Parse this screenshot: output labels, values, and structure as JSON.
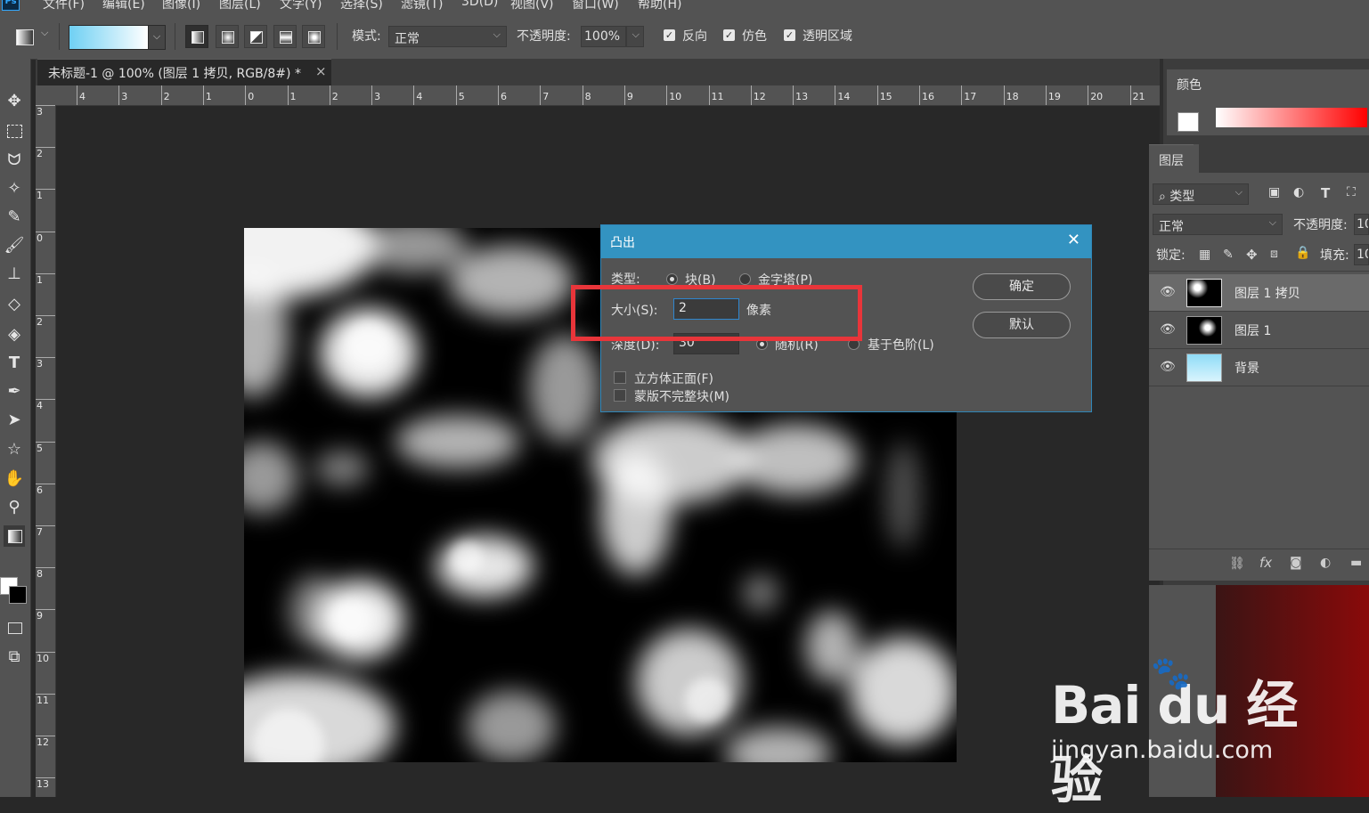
{
  "menubar": {
    "app_logo": "Ps",
    "items": [
      "文件(F)",
      "编辑(E)",
      "图像(I)",
      "图层(L)",
      "文字(Y)",
      "选择(S)",
      "滤镜(T)",
      "3D(D)",
      "视图(V)",
      "窗口(W)",
      "帮助(H)"
    ]
  },
  "options_bar": {
    "mode_label": "模式:",
    "mode_value": "正常",
    "opacity_label": "不透明度:",
    "opacity_value": "100%",
    "reverse_label": "反向",
    "dither_label": "仿色",
    "transparency_label": "透明区域",
    "gradient_colors": [
      "#6fd0f3",
      "#ffffff"
    ]
  },
  "document": {
    "tab_title": "未标题-1 @ 100% (图层 1 拷贝, RGB/8#) *",
    "close_glyph": "×"
  },
  "rulers": {
    "horizontal": [
      "4",
      "3",
      "2",
      "1",
      "0",
      "1",
      "2",
      "3",
      "4",
      "5",
      "6",
      "7",
      "8",
      "9",
      "10",
      "11",
      "12",
      "13",
      "14",
      "15",
      "16",
      "17",
      "18",
      "19",
      "20",
      "21"
    ],
    "vertical": [
      "3",
      "2",
      "1",
      "0",
      "1",
      "2",
      "3",
      "4",
      "5",
      "6",
      "7",
      "8",
      "9",
      "10",
      "11",
      "12",
      "13"
    ]
  },
  "color_panel": {
    "tab": "颜色"
  },
  "layers_panel": {
    "tab": "图层",
    "filter_label": "类型",
    "blend_mode": "正常",
    "opacity_label": "不透明度:",
    "opacity_value": "10",
    "lock_label": "锁定:",
    "fill_label": "填充:",
    "fill_value": "10",
    "layers": [
      {
        "name": "图层 1 拷贝",
        "selected": true
      },
      {
        "name": "图层 1",
        "selected": false
      },
      {
        "name": "背景",
        "selected": false
      }
    ],
    "footer_fx": "fx"
  },
  "dialog": {
    "title": "凸出",
    "type_label": "类型:",
    "type_block": "块(B)",
    "type_pyramid": "金字塔(P)",
    "size_label": "大小(S):",
    "size_value": "2",
    "size_unit": "像素",
    "depth_label": "深度(D):",
    "depth_value": "30",
    "random_label": "随机(R)",
    "level_label": "基于色阶(L)",
    "solid_front_label": "立方体正面(F)",
    "mask_label": "蒙版不完整块(M)",
    "ok_button": "确定",
    "default_button": "默认"
  },
  "watermark": {
    "brand": "Bai du 经验",
    "url": "jingyan.baidu.com"
  }
}
